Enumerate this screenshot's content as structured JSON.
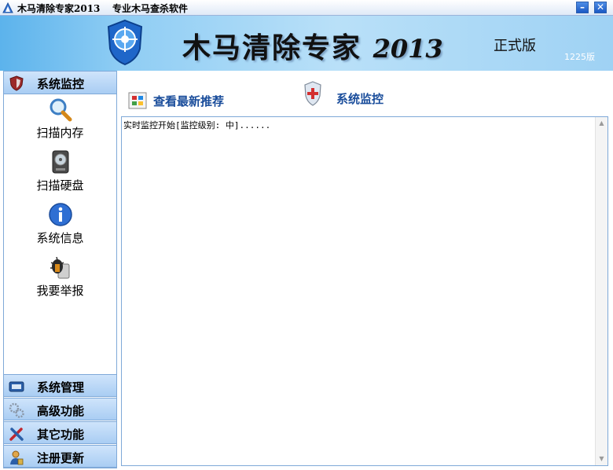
{
  "window": {
    "title": "木马清除专家2013",
    "subtitle": "专业木马查杀软件",
    "minimize": "–",
    "close": "✕"
  },
  "banner": {
    "title": "木马清除专家",
    "year": "2013",
    "edition": "正式版",
    "build": "1225版"
  },
  "sidebar": {
    "active_section": "系统监控",
    "tools": [
      {
        "label": "扫描内存",
        "icon": "magnifier-icon"
      },
      {
        "label": "扫描硬盘",
        "icon": "harddisk-icon"
      },
      {
        "label": "系统信息",
        "icon": "info-icon"
      },
      {
        "label": "我要举报",
        "icon": "bug-report-icon"
      }
    ],
    "sections": [
      {
        "label": "系统管理",
        "icon": "system-manage-icon"
      },
      {
        "label": "高级功能",
        "icon": "gears-icon"
      },
      {
        "label": "其它功能",
        "icon": "tools-icon"
      },
      {
        "label": "注册更新",
        "icon": "user-register-icon"
      }
    ]
  },
  "main": {
    "recommend_link": "查看最新推荐",
    "monitor_title": "系统监控",
    "log_text": "实时监控开始[监控级别: 中]......"
  },
  "colors": {
    "banner": "#8fcdf4",
    "sidebar_header": "#a9cdf3",
    "border": "#7fa9d8",
    "link": "#1a4d9b"
  }
}
